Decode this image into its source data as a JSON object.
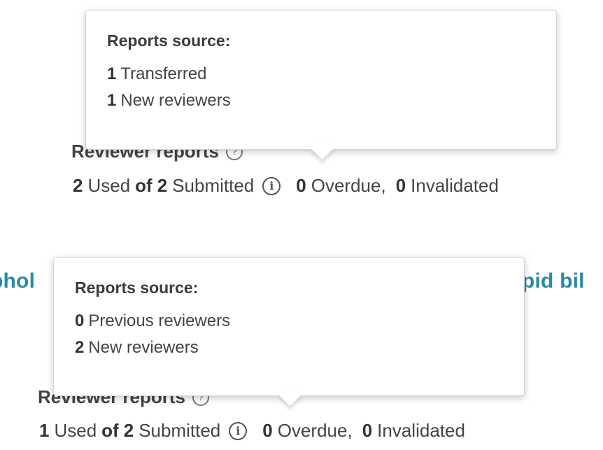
{
  "block1": {
    "popover": {
      "title": "Reports source:",
      "rows": [
        {
          "count": "1",
          "label": "Transferred"
        },
        {
          "count": "1",
          "label": "New reviewers"
        }
      ]
    },
    "heading": "Reviewer reports",
    "stats": {
      "used": "2",
      "used_label": "Used",
      "of_label": "of",
      "submitted": "2",
      "submitted_label": "Submitted",
      "overdue": "0",
      "overdue_label": "Overdue,",
      "invalidated": "0",
      "invalidated_label": "Invalidated"
    }
  },
  "block2": {
    "title_fragment_left": "phol",
    "title_fragment_right": "pid bil",
    "popover": {
      "title": "Reports source:",
      "rows": [
        {
          "count": "0",
          "label": "Previous reviewers"
        },
        {
          "count": "2",
          "label": "New reviewers"
        }
      ]
    },
    "heading": "Reviewer reports",
    "stats": {
      "used": "1",
      "used_label": "Used",
      "of_label": "of",
      "submitted": "2",
      "submitted_label": "Submitted",
      "overdue": "0",
      "overdue_label": "Overdue,",
      "invalidated": "0",
      "invalidated_label": "Invalidated"
    }
  },
  "icons": {
    "help": "?",
    "info": "i"
  },
  "colors": {
    "title_link": "#2a8aa3",
    "text": "#444444",
    "popover_border": "#d4d4d4"
  }
}
